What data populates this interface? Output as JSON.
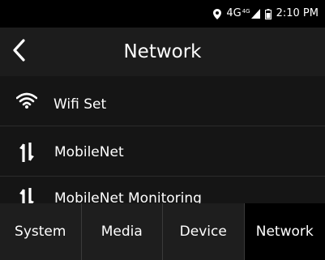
{
  "status_bar": {
    "network_label": "4G",
    "network_superscript": "4G",
    "time": "2:10 PM"
  },
  "header": {
    "title": "Network",
    "back_icon": "chevron-left-icon"
  },
  "list": {
    "items": [
      {
        "label": "Wifi Set",
        "icon": "wifi-icon"
      },
      {
        "label": "MobileNet",
        "icon": "mobile-data-arrows-icon"
      },
      {
        "label": "MobileNet Monitoring",
        "icon": "mobile-data-arrows-icon"
      }
    ]
  },
  "tabs": [
    {
      "label": "System",
      "active": false
    },
    {
      "label": "Media",
      "active": false
    },
    {
      "label": "Device",
      "active": false
    },
    {
      "label": "Network",
      "active": true
    }
  ],
  "colors": {
    "background": "#000000",
    "header": "#1c1c1c",
    "list_bg": "#151515",
    "tabbar": "#1e1e1e",
    "text": "#ffffff"
  }
}
